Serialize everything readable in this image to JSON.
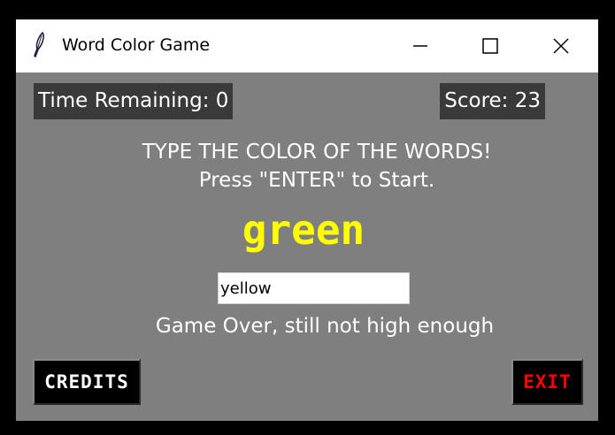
{
  "window": {
    "title": "Word Color Game"
  },
  "header": {
    "timer_text": "Time Remaining: 0",
    "score_text": "Score: 23"
  },
  "instructions": {
    "line1": "TYPE THE COLOR OF THE WORDS!",
    "line2": "Press \"ENTER\" to Start."
  },
  "game": {
    "word": "green",
    "word_color": "#ffff00",
    "answer_value": "yellow",
    "status": "Game Over, still not high enough"
  },
  "buttons": {
    "credits_label": "CREDITS",
    "credits_color": "#ffffff",
    "exit_label": "EXIT",
    "exit_color": "#ff0000"
  },
  "colors": {
    "background": "#7f7f7f",
    "label_bg": "#3a3a3a"
  }
}
